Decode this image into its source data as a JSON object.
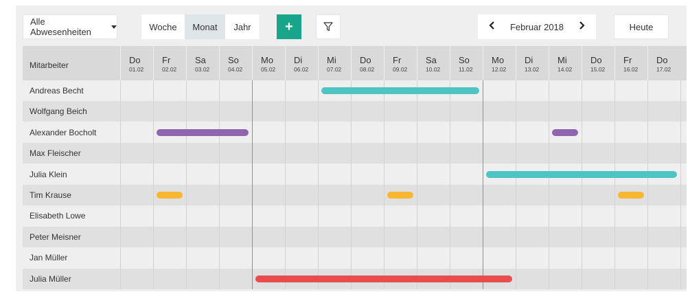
{
  "toolbar": {
    "filter_dropdown": "Alle Abwesenheiten",
    "views": [
      "Woche",
      "Monat",
      "Jahr"
    ],
    "active_view": "Monat",
    "add_label": "+",
    "month_label": "Februar 2018",
    "prev_label": "‹",
    "next_label": "›",
    "today_label": "Heute"
  },
  "grid": {
    "header_label": "Mitarbeiter",
    "days": [
      {
        "name": "Do",
        "date": "01.02"
      },
      {
        "name": "Fr",
        "date": "02.02"
      },
      {
        "name": "Sa",
        "date": "03.02"
      },
      {
        "name": "So",
        "date": "04.02"
      },
      {
        "name": "Mo",
        "date": "05.02"
      },
      {
        "name": "Di",
        "date": "06.02"
      },
      {
        "name": "Mi",
        "date": "07.02"
      },
      {
        "name": "Do",
        "date": "08.02"
      },
      {
        "name": "Fr",
        "date": "09.02"
      },
      {
        "name": "Sa",
        "date": "10.02"
      },
      {
        "name": "So",
        "date": "11.02"
      },
      {
        "name": "Mo",
        "date": "12.02"
      },
      {
        "name": "Di",
        "date": "13.02"
      },
      {
        "name": "Mi",
        "date": "14.02"
      },
      {
        "name": "Do",
        "date": "15.02"
      },
      {
        "name": "Fr",
        "date": "16.02"
      },
      {
        "name": "Do",
        "date": "17.02"
      }
    ],
    "employees": [
      {
        "name": "Andreas Becht",
        "absences": [
          {
            "start": "07.02",
            "end": "11.02",
            "color": "#4fc4c4"
          }
        ]
      },
      {
        "name": "Wolfgang Beich",
        "absences": []
      },
      {
        "name": "Alexander Bocholt",
        "absences": [
          {
            "start": "02.02",
            "end": "04.02",
            "color": "#9065b0"
          },
          {
            "start": "14.02",
            "end": "14.02",
            "color": "#9065b0"
          }
        ]
      },
      {
        "name": "Max Fleischer",
        "absences": []
      },
      {
        "name": "Julia Klein",
        "absences": [
          {
            "start": "12.02",
            "end": "17.02",
            "color": "#4fc4c4"
          }
        ]
      },
      {
        "name": "Tim Krause",
        "absences": [
          {
            "start": "02.02",
            "end": "02.02",
            "color": "#f7b733"
          },
          {
            "start": "09.02",
            "end": "09.02",
            "color": "#f7b733"
          },
          {
            "start": "16.02",
            "end": "16.02",
            "color": "#f7b733"
          }
        ]
      },
      {
        "name": "Elisabeth Lowe",
        "absences": []
      },
      {
        "name": "Peter Meisner",
        "absences": []
      },
      {
        "name": "Jan Müller",
        "absences": []
      },
      {
        "name": "Julia Müller",
        "absences": [
          {
            "start": "05.02",
            "end": "12.02",
            "color": "#e84c4c"
          }
        ]
      }
    ]
  },
  "colors": {
    "accent": "#19a58c"
  }
}
